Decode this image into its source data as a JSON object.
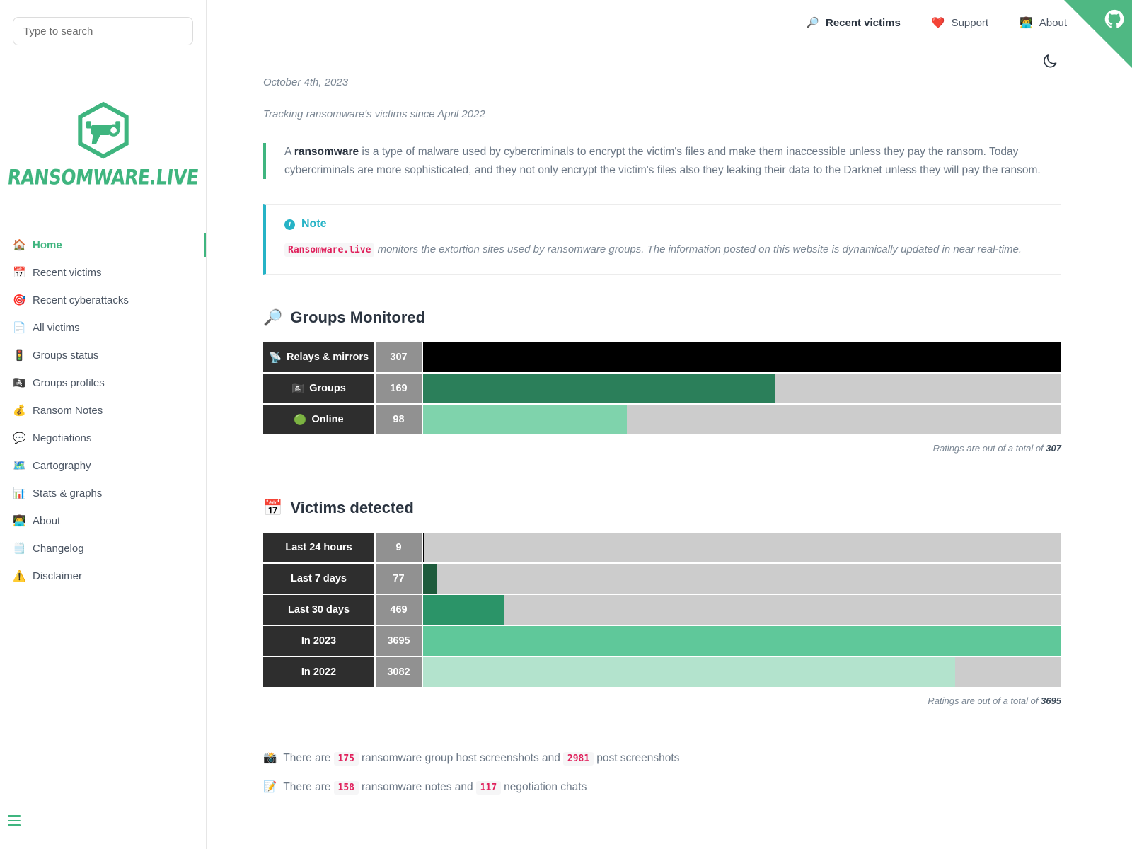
{
  "sidebar": {
    "search": {
      "placeholder": "Type to search",
      "value": ""
    },
    "brand": {
      "name": "RANSOMWARE.LIVE",
      "logo_icon": "cctv-hexagon-logo"
    },
    "items": [
      {
        "icon": "🏠",
        "icon_name": "house-icon",
        "label": "Home",
        "active": true
      },
      {
        "icon": "📅",
        "icon_name": "calendar-icon",
        "label": "Recent victims",
        "active": false
      },
      {
        "icon": "🎯",
        "icon_name": "target-icon",
        "label": "Recent cyberattacks",
        "active": false
      },
      {
        "icon": "📄",
        "icon_name": "document-icon",
        "label": "All victims",
        "active": false
      },
      {
        "icon": "🚦",
        "icon_name": "traffic-light-icon",
        "label": "Groups status",
        "active": false
      },
      {
        "icon": "🏴‍☠️",
        "icon_name": "pirate-flag-icon",
        "label": "Groups profiles",
        "active": false
      },
      {
        "icon": "💰",
        "icon_name": "money-bag-icon",
        "label": "Ransom Notes",
        "active": false
      },
      {
        "icon": "💬",
        "icon_name": "speech-bubble-icon",
        "label": "Negotiations",
        "active": false
      },
      {
        "icon": "🗺️",
        "icon_name": "map-icon",
        "label": "Cartography",
        "active": false
      },
      {
        "icon": "📊",
        "icon_name": "bar-chart-icon",
        "label": "Stats & graphs",
        "active": false
      },
      {
        "icon": "👨‍💻",
        "icon_name": "person-icon",
        "label": "About",
        "active": false
      },
      {
        "icon": "🗒️",
        "icon_name": "note-icon",
        "label": "Changelog",
        "active": false
      },
      {
        "icon": "⚠️",
        "icon_name": "warning-icon",
        "label": "Disclaimer",
        "active": false
      }
    ],
    "menu_toggle_icon": "hamburger-icon"
  },
  "topbar": {
    "links": [
      {
        "icon": "🔎",
        "icon_name": "magnifier-icon",
        "label": "Recent victims",
        "strong": true
      },
      {
        "icon": "❤️",
        "icon_name": "heart-icon",
        "label": "Support",
        "strong": false
      },
      {
        "icon": "👨‍💻",
        "icon_name": "person-icon",
        "label": "About",
        "strong": false
      }
    ],
    "theme_toggle_icon": "moon-icon",
    "corner_ribbon_icon": "github-cat-icon"
  },
  "main": {
    "date": "October 4th, 2023",
    "tagline": "Tracking ransomware's victims since April 2022",
    "intro": {
      "before": "A ",
      "keyword": "ransomware",
      "after": " is a type of malware used by cybercriminals to encrypt the victim's files and make them inaccessible unless they pay the ransom. Today cybercriminals are more sophisticated, and they not only encrypt the victim's files also they leaking their data to the Darknet unless they will pay the ransom."
    },
    "note": {
      "icon": "i",
      "title": "Note",
      "code": "Ransomware.live",
      "body": " monitors the extortion sites used by ransomware groups. The information posted on this website is dynamically updated in near real-time."
    },
    "groups_section": {
      "icon": "🔎",
      "icon_name": "magnifier-icon",
      "title": "Groups Monitored",
      "footnote_prefix": "Ratings are out of a total of ",
      "footnote_total": "307"
    },
    "victims_section": {
      "icon": "📅",
      "icon_name": "calendar-icon",
      "title": "Victims detected",
      "footnote_prefix": "Ratings are out of a total of ",
      "footnote_total": "3695"
    },
    "facts": [
      {
        "icon": "📸",
        "icon_name": "camera-icon",
        "p1": "There are",
        "n1": "175",
        "p2": "ransomware group host screenshots and",
        "n2": "2981",
        "p3": "post screenshots"
      },
      {
        "icon": "📝",
        "icon_name": "memo-icon",
        "p1": "There are",
        "n1": "158",
        "p2": "ransomware notes and",
        "n2": "117",
        "p3": "negotiation chats"
      }
    ]
  },
  "chart_data": [
    {
      "type": "bar",
      "title": "Groups Monitored",
      "orientation": "horizontal",
      "categories": [
        "Relays & mirrors",
        "Groups",
        "Online"
      ],
      "values": [
        307,
        169,
        98
      ],
      "total": 307,
      "track_color": "#cccccc",
      "bar_colors": [
        "#000000",
        "#2b7f5a",
        "#7fd3ac"
      ],
      "row_icons": [
        "📡",
        "🏴‍☠️",
        "🟢"
      ],
      "grid": false,
      "legend": "none"
    },
    {
      "type": "bar",
      "title": "Victims detected",
      "orientation": "horizontal",
      "categories": [
        "Last 24 hours",
        "Last 7 days",
        "Last 30 days",
        "In 2023",
        "In 2022"
      ],
      "values": [
        9,
        77,
        469,
        3695,
        3082
      ],
      "total": 3695,
      "track_color": "#cccccc",
      "bar_colors": [
        "#000000",
        "#1e5b3c",
        "#2b9468",
        "#5fc89a",
        "#b3e3cd"
      ],
      "row_icons": [
        "",
        "",
        "",
        "",
        ""
      ],
      "grid": false,
      "legend": "none"
    }
  ]
}
